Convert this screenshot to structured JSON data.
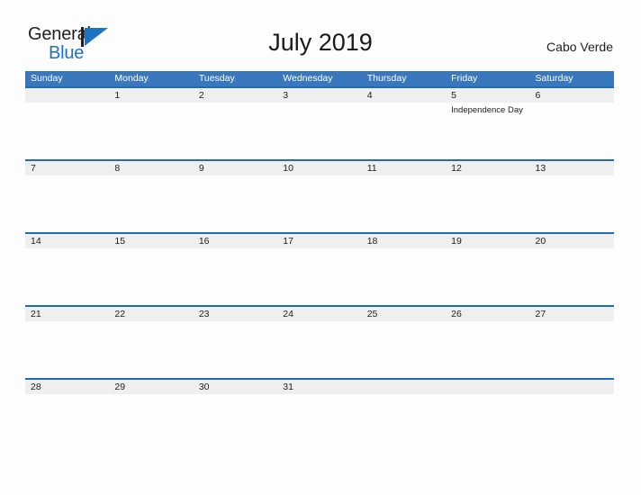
{
  "branding": {
    "logo_text_primary": "General",
    "logo_text_secondary": "Blue",
    "logo_mark": "triangle-flag-icon",
    "primary_color": "#1f73c0",
    "dark_color": "#231f20"
  },
  "header": {
    "title": "July 2019",
    "region": "Cabo Verde"
  },
  "colors": {
    "weekday_header_bg": "#3a78bd",
    "weekday_header_text": "#ffffff",
    "week_row_border": "#1f6cb0",
    "daynum_band_bg": "#efefef",
    "page_bg": "#fdfdfd",
    "text": "#1d1d1d"
  },
  "calendar": {
    "weekdays": [
      "Sunday",
      "Monday",
      "Tuesday",
      "Wednesday",
      "Thursday",
      "Friday",
      "Saturday"
    ],
    "weeks": [
      {
        "days": [
          {
            "number": "",
            "events": []
          },
          {
            "number": "1",
            "events": []
          },
          {
            "number": "2",
            "events": []
          },
          {
            "number": "3",
            "events": []
          },
          {
            "number": "4",
            "events": []
          },
          {
            "number": "5",
            "events": [
              "Independence Day"
            ]
          },
          {
            "number": "6",
            "events": []
          }
        ]
      },
      {
        "days": [
          {
            "number": "7",
            "events": []
          },
          {
            "number": "8",
            "events": []
          },
          {
            "number": "9",
            "events": []
          },
          {
            "number": "10",
            "events": []
          },
          {
            "number": "11",
            "events": []
          },
          {
            "number": "12",
            "events": []
          },
          {
            "number": "13",
            "events": []
          }
        ]
      },
      {
        "days": [
          {
            "number": "14",
            "events": []
          },
          {
            "number": "15",
            "events": []
          },
          {
            "number": "16",
            "events": []
          },
          {
            "number": "17",
            "events": []
          },
          {
            "number": "18",
            "events": []
          },
          {
            "number": "19",
            "events": []
          },
          {
            "number": "20",
            "events": []
          }
        ]
      },
      {
        "days": [
          {
            "number": "21",
            "events": []
          },
          {
            "number": "22",
            "events": []
          },
          {
            "number": "23",
            "events": []
          },
          {
            "number": "24",
            "events": []
          },
          {
            "number": "25",
            "events": []
          },
          {
            "number": "26",
            "events": []
          },
          {
            "number": "27",
            "events": []
          }
        ]
      },
      {
        "days": [
          {
            "number": "28",
            "events": []
          },
          {
            "number": "29",
            "events": []
          },
          {
            "number": "30",
            "events": []
          },
          {
            "number": "31",
            "events": []
          },
          {
            "number": "",
            "events": []
          },
          {
            "number": "",
            "events": []
          },
          {
            "number": "",
            "events": []
          }
        ]
      }
    ]
  }
}
